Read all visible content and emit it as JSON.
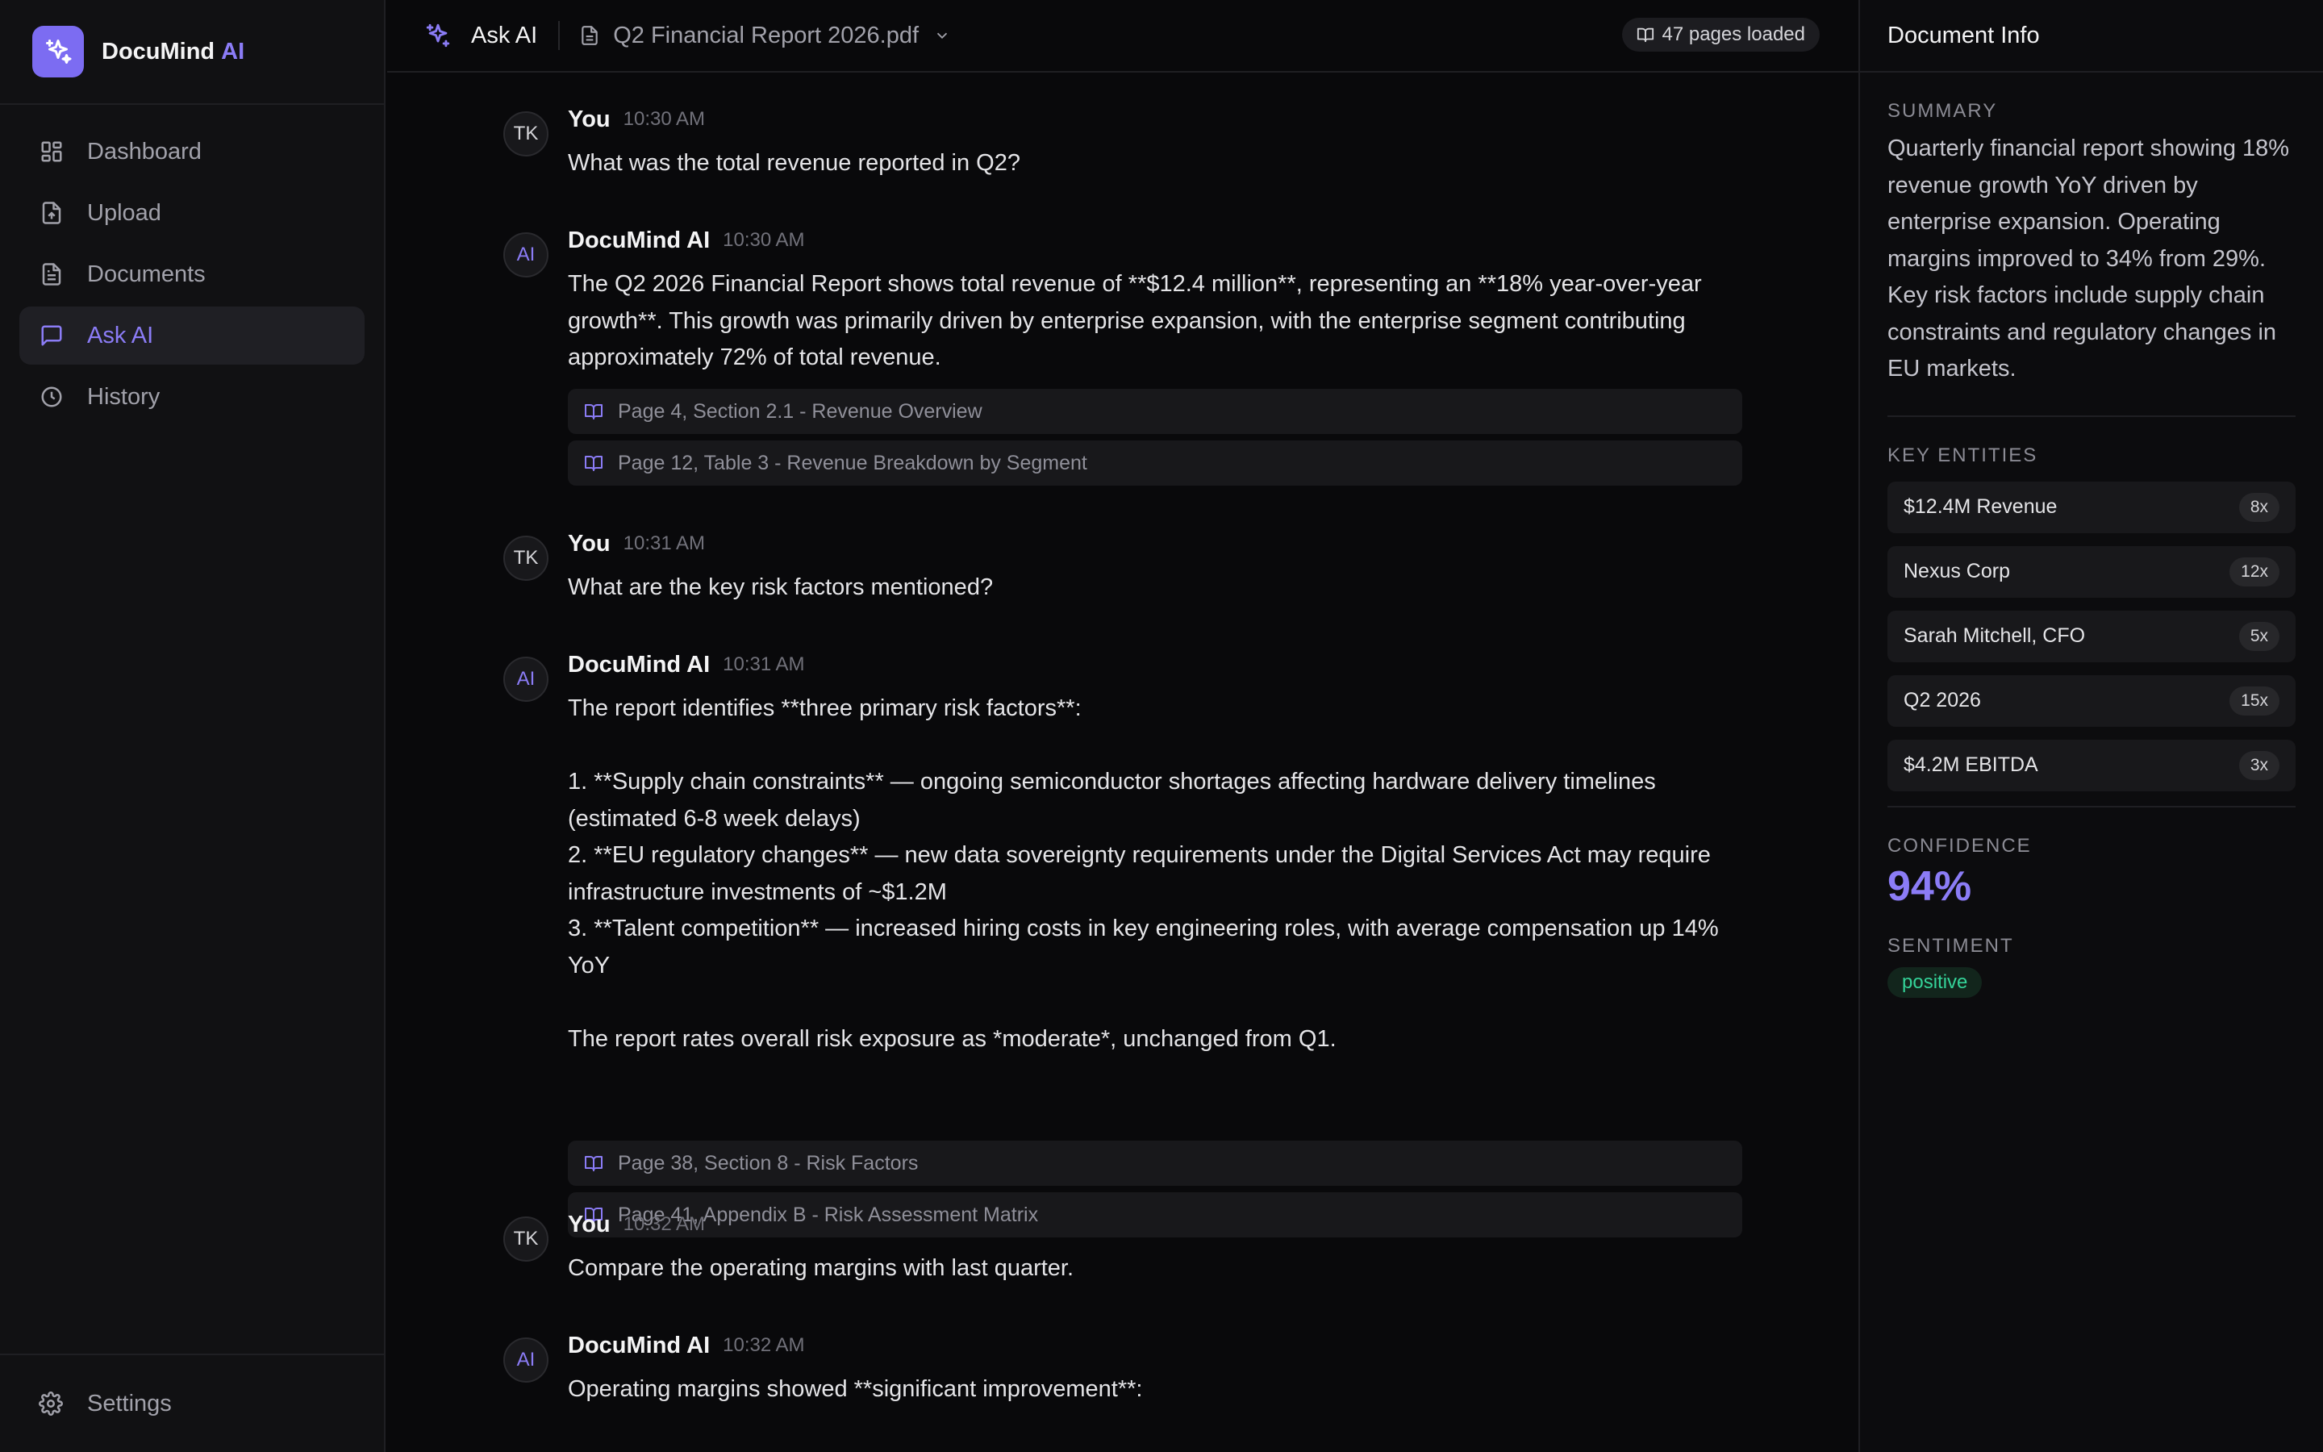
{
  "brand": {
    "name": "DocuMind",
    "accent": "AI"
  },
  "sidebar": {
    "items": [
      {
        "label": "Dashboard",
        "icon": "dashboard-icon"
      },
      {
        "label": "Upload",
        "icon": "upload-icon"
      },
      {
        "label": "Documents",
        "icon": "documents-icon"
      },
      {
        "label": "Ask AI",
        "icon": "chat-icon",
        "active": true
      },
      {
        "label": "History",
        "icon": "clock-icon"
      }
    ],
    "settings_label": "Settings"
  },
  "topbar": {
    "title": "Ask AI",
    "document": "Q2 Financial Report 2026.pdf",
    "pages_loaded": "47 pages loaded"
  },
  "chat": {
    "messages": [
      {
        "avatar": "TK",
        "author": "You",
        "time": "10:30 AM",
        "text": "What was the total revenue reported in Q2?"
      },
      {
        "avatar": "AI",
        "author": "DocuMind AI",
        "time": "10:30 AM",
        "text": "The Q2 2026 Financial Report shows total revenue of **$12.4 million**, representing an **18% year-over-year growth**. This growth was primarily driven by enterprise expansion, with the enterprise segment contributing approximately 72% of total revenue.",
        "citations": [
          "Page 4, Section 2.1 - Revenue Overview",
          "Page 12, Table 3 - Revenue Breakdown by Segment"
        ]
      },
      {
        "avatar": "TK",
        "author": "You",
        "time": "10:31 AM",
        "text": "What are the key risk factors mentioned?"
      },
      {
        "avatar": "AI",
        "author": "DocuMind AI",
        "time": "10:31 AM",
        "text": "The report identifies **three primary risk factors**:\n\n1. **Supply chain constraints** — ongoing semiconductor shortages affecting hardware delivery timelines (estimated 6-8 week delays)\n2. **EU regulatory changes** — new data sovereignty requirements under the Digital Services Act may require infrastructure investments of ~$1.2M\n3. **Talent competition** — increased hiring costs in key engineering roles, with average compensation up 14% YoY\n\nThe report rates overall risk exposure as *moderate*, unchanged from Q1.",
        "citations": [
          "Page 38, Section 8 - Risk Factors",
          "Page 41, Appendix B - Risk Assessment Matrix"
        ]
      },
      {
        "avatar": "TK",
        "author": "You",
        "time": "10:32 AM",
        "text": "Compare the operating margins with last quarter."
      },
      {
        "avatar": "AI",
        "author": "DocuMind AI",
        "time": "10:32 AM",
        "text": "Operating margins showed **significant improvement**:"
      }
    ]
  },
  "panel": {
    "title": "Document Info",
    "summary_label": "SUMMARY",
    "summary": "Quarterly financial report showing 18% revenue growth YoY driven by enterprise expansion. Operating margins improved to 34% from 29%. Key risk factors include supply chain constraints and regulatory changes in EU markets.",
    "entities_label": "KEY ENTITIES",
    "entities": [
      {
        "name": "$12.4M Revenue",
        "count": "8x"
      },
      {
        "name": "Nexus Corp",
        "count": "12x"
      },
      {
        "name": "Sarah Mitchell, CFO",
        "count": "5x"
      },
      {
        "name": "Q2 2026",
        "count": "15x"
      },
      {
        "name": "$4.2M EBITDA",
        "count": "3x"
      }
    ],
    "confidence_label": "CONFIDENCE",
    "confidence": "94%",
    "sentiment_label": "SENTIMENT",
    "sentiment": "positive"
  },
  "colors": {
    "accent": "#8b7cf6",
    "background": "#09090b",
    "positive": "#34d399"
  }
}
